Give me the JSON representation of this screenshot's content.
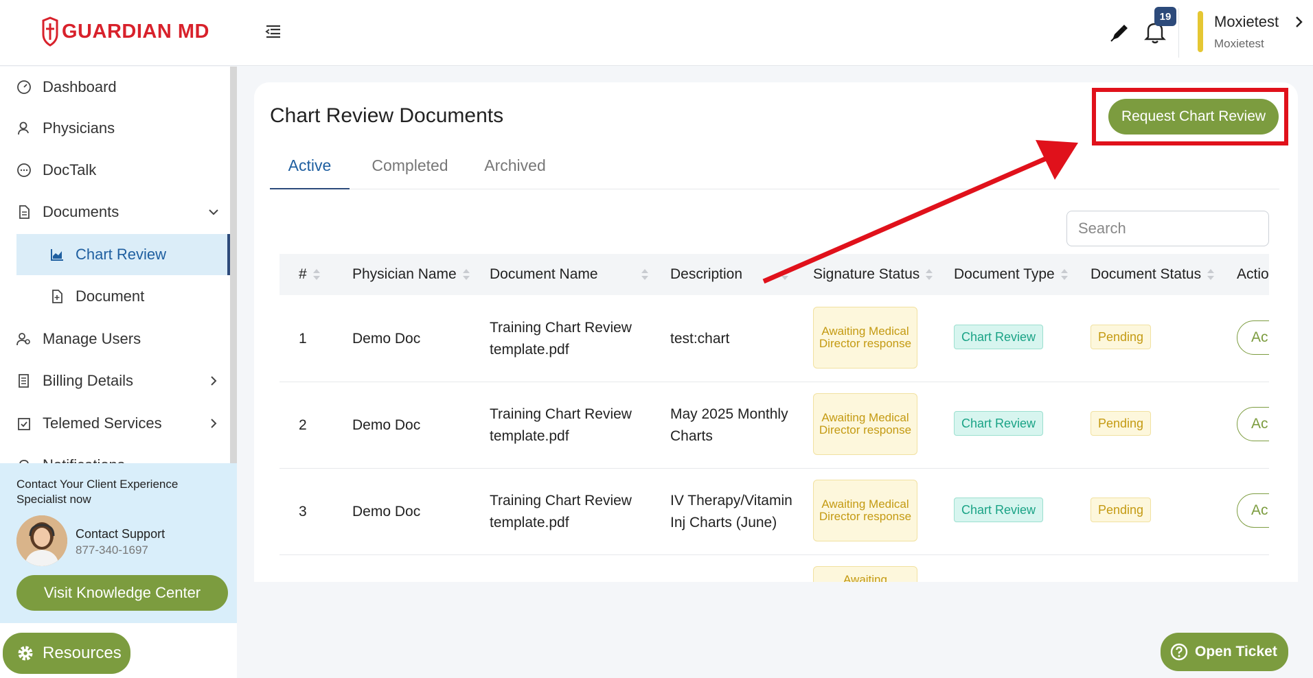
{
  "brand": {
    "name": "GUARDIAN MD",
    "color": "#d8212b",
    "accent": "#7c9c3f"
  },
  "header": {
    "notification_count": "19",
    "user_name": "Moxietest",
    "user_org": "Moxietest"
  },
  "sidebar": {
    "items": [
      {
        "label": "Dashboard",
        "icon": "gauge-icon"
      },
      {
        "label": "Physicians",
        "icon": "user-icon"
      },
      {
        "label": "DocTalk",
        "icon": "chat-icon"
      },
      {
        "label": "Documents",
        "icon": "document-icon",
        "expanded": true
      },
      {
        "label": "Chart Review",
        "icon": "chart-icon",
        "active": true
      },
      {
        "label": "Document",
        "icon": "file-plus-icon"
      },
      {
        "label": "Manage Users",
        "icon": "users-icon"
      },
      {
        "label": "Billing Details",
        "icon": "receipt-icon"
      },
      {
        "label": "Telemed Services",
        "icon": "calendar-check-icon"
      },
      {
        "label": "Notifications",
        "icon": "bell-icon"
      }
    ],
    "support": {
      "title": "Contact Your Client Experience Specialist now",
      "contact_label": "Contact Support",
      "phone": "877-340-1697",
      "knowledge_button": "Visit Knowledge Center"
    },
    "resources_button": "Resources"
  },
  "main": {
    "title": "Chart Review Documents",
    "request_button": "Request Chart Review",
    "tabs": [
      {
        "label": "Active",
        "active": true
      },
      {
        "label": "Completed"
      },
      {
        "label": "Archived"
      }
    ],
    "search_placeholder": "Search",
    "table": {
      "columns": [
        "#",
        "Physician Name",
        "Document Name",
        "Description",
        "Signature Status",
        "Document Type",
        "Document Status",
        "Actions"
      ],
      "rows": [
        {
          "num": "1",
          "physician": "Demo Doc",
          "document": "Training Chart Review template.pdf",
          "description": "test:chart",
          "signature": "Awaiting Medical Director response",
          "type": "Chart Review",
          "status": "Pending",
          "action": "Ac"
        },
        {
          "num": "2",
          "physician": "Demo Doc",
          "document": "Training Chart Review template.pdf",
          "description": "May 2025 Monthly Charts",
          "signature": "Awaiting Medical Director response",
          "type": "Chart Review",
          "status": "Pending",
          "action": "Ac"
        },
        {
          "num": "3",
          "physician": "Demo Doc",
          "document": "Training Chart Review template.pdf",
          "description": "IV Therapy/Vitamin Inj Charts (June)",
          "signature": "Awaiting Medical Director response",
          "type": "Chart Review",
          "status": "Pending",
          "action": "Ac"
        },
        {
          "signature": "Awaiting"
        }
      ]
    }
  },
  "open_ticket_button": "Open Ticket"
}
